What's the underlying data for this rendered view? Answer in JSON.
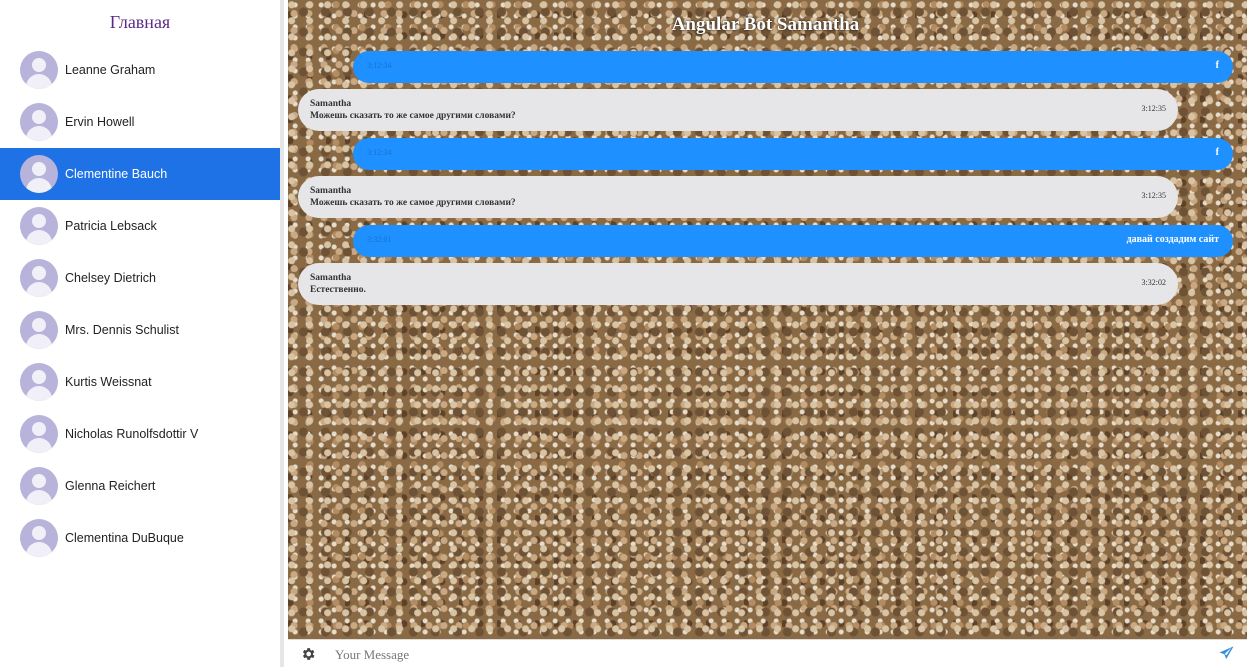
{
  "sidebar": {
    "title": "Главная",
    "users": [
      {
        "name": "Leanne Graham"
      },
      {
        "name": "Ervin Howell"
      },
      {
        "name": "Clementine Bauch"
      },
      {
        "name": "Patricia Lebsack"
      },
      {
        "name": "Chelsey Dietrich"
      },
      {
        "name": "Mrs. Dennis Schulist"
      },
      {
        "name": "Kurtis Weissnat"
      },
      {
        "name": "Nicholas Runolfsdottir V"
      },
      {
        "name": "Glenna Reichert"
      },
      {
        "name": "Clementina DuBuque"
      }
    ],
    "active_user": "Clementine Bauch",
    "active_color": "#1f72e6"
  },
  "chat": {
    "title": "Angular Bot Samantha",
    "messages": [
      {
        "type": "out",
        "time": "3:12:34",
        "text": "f"
      },
      {
        "type": "in",
        "sender": "Samantha",
        "time": "3:12:35",
        "text": "Можешь сказать то же самое другими словами?"
      },
      {
        "type": "out",
        "time": "3:12:34",
        "text": "f"
      },
      {
        "type": "in",
        "sender": "Samantha",
        "time": "3:12:35",
        "text": "Можешь сказать то же самое другими словами?"
      },
      {
        "type": "out",
        "time": "3:32:01",
        "text": "давай создадим сайт"
      },
      {
        "type": "in",
        "sender": "Samantha",
        "time": "3:32:02",
        "text": "Естественно."
      }
    ],
    "outgoing_color": "#1e90ff",
    "incoming_color": "#e6e5e8"
  },
  "composer": {
    "placeholder": "Your Message",
    "value": "",
    "settings_icon": "gear-icon",
    "send_icon": "send-icon"
  }
}
